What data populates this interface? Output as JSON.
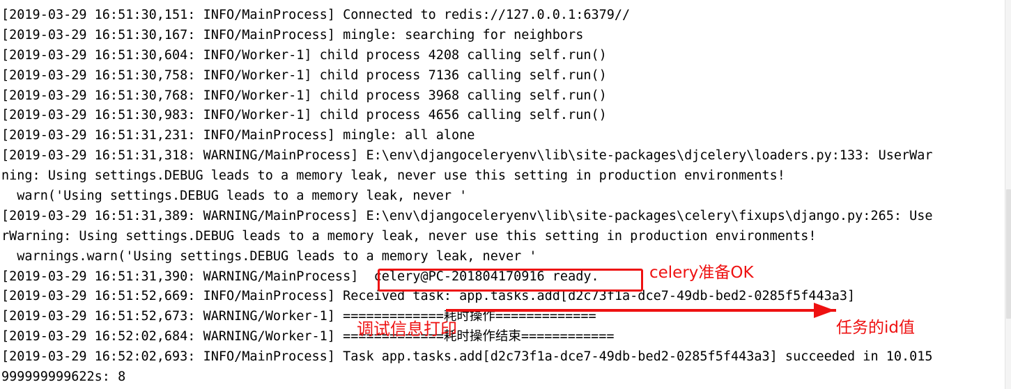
{
  "terminal": {
    "background_color": "#ffffff",
    "text_color": "#000000",
    "accent_color": "#ee1111",
    "lines": [
      "[2019-03-29 16:51:30,151: INFO/MainProcess] Connected to redis://127.0.0.1:6379//",
      "[2019-03-29 16:51:30,167: INFO/MainProcess] mingle: searching for neighbors",
      "[2019-03-29 16:51:30,604: INFO/Worker-1] child process 4208 calling self.run()",
      "[2019-03-29 16:51:30,758: INFO/Worker-1] child process 7136 calling self.run()",
      "[2019-03-29 16:51:30,768: INFO/Worker-1] child process 3968 calling self.run()",
      "[2019-03-29 16:51:30,983: INFO/Worker-1] child process 4656 calling self.run()",
      "[2019-03-29 16:51:31,231: INFO/MainProcess] mingle: all alone",
      "[2019-03-29 16:51:31,318: WARNING/MainProcess] E:\\env\\djangoceleryenv\\lib\\site-packages\\djcelery\\loaders.py:133: UserWar",
      "ning: Using settings.DEBUG leads to a memory leak, never use this setting in production environments!",
      "  warn('Using settings.DEBUG leads to a memory leak, never '",
      "[2019-03-29 16:51:31,389: WARNING/MainProcess] E:\\env\\djangoceleryenv\\lib\\site-packages\\celery\\fixups\\django.py:265: Use",
      "rWarning: Using settings.DEBUG leads to a memory leak, never use this setting in production environments!",
      "  warnings.warn('Using settings.DEBUG leads to a memory leak, never '",
      "[2019-03-29 16:51:31,390: WARNING/MainProcess]  celery@PC-201804170916 ready.",
      "[2019-03-29 16:51:52,669: INFO/MainProcess] Received task: app.tasks.add[d2c73f1a-dce7-49db-bed2-0285f5f443a3]",
      "[2019-03-29 16:51:52,673: WARNING/Worker-1] =============耗时操作=============",
      "[2019-03-29 16:52:02,684: WARNING/Worker-1] =============耗时操作结束============",
      "[2019-03-29 16:52:02,693: INFO/MainProcess] Task app.tasks.add[d2c73f1a-dce7-49db-bed2-0285f5f443a3] succeeded in 10.015",
      "999999999622s: 8"
    ]
  },
  "annotations": {
    "celery_ready_label": "celery准备OK",
    "task_id_label": "任务的id值",
    "debug_print_label": "调试信息打印"
  },
  "scrollbar": {
    "orientation": "vertical"
  }
}
